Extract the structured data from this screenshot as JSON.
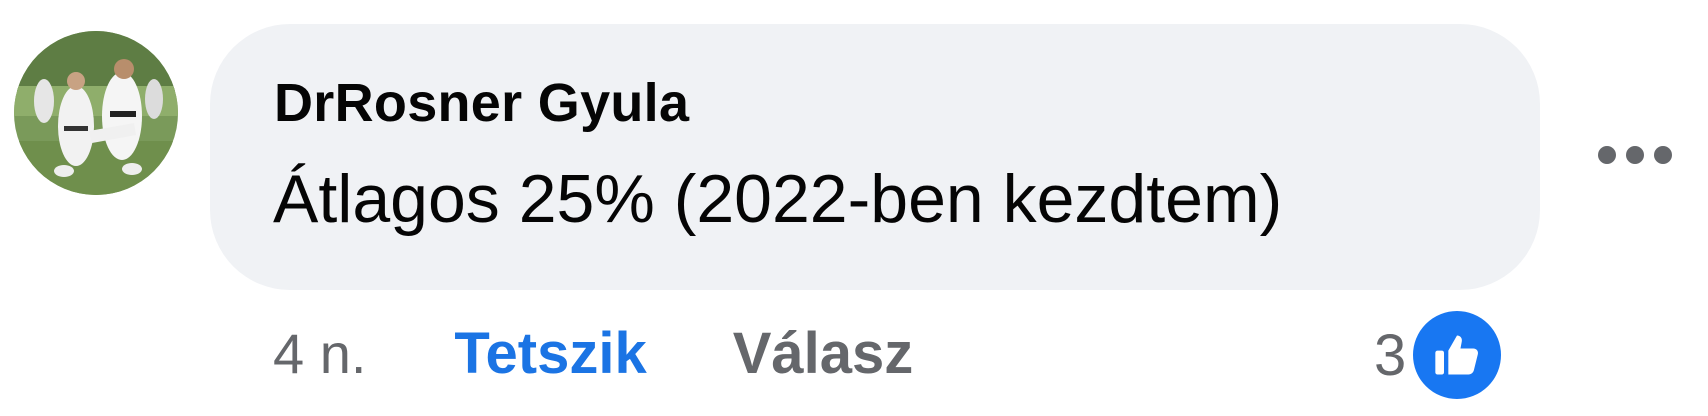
{
  "comment": {
    "author": "DrRosner Gyula",
    "text": "Átlagos 25% (2022-ben kezdtem)",
    "time": "4 n.",
    "like_label": "Tetszik",
    "reply_label": "Válasz",
    "reaction_count": "3",
    "reaction_type": "like-icon",
    "more_icon": "more-options-icon"
  },
  "colors": {
    "bubble": "#f0f2f5",
    "like_active": "#1b74e4",
    "secondary_text": "#65676b",
    "reaction_badge": "#1877f2"
  }
}
